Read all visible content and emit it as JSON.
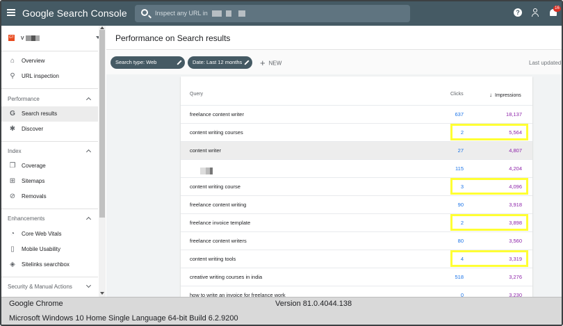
{
  "topbar": {
    "brand": "Google Search Console",
    "search_placeholder": "Inspect any URL in",
    "notification_count": "16",
    "help_glyph": "?"
  },
  "sidebar": {
    "property_name": "v",
    "property_favicon_text": "GT",
    "items": [
      {
        "label": "Overview",
        "icon": "home-icon"
      },
      {
        "label": "URL inspection",
        "icon": "search-icon"
      },
      {
        "section": "Performance"
      },
      {
        "label": "Search results",
        "icon": "google-g-icon",
        "active": true
      },
      {
        "label": "Discover",
        "icon": "asterisk-icon"
      },
      {
        "section": "Index"
      },
      {
        "label": "Coverage",
        "icon": "file-copy-icon"
      },
      {
        "label": "Sitemaps",
        "icon": "sitemap-icon"
      },
      {
        "label": "Removals",
        "icon": "eye-off-icon"
      },
      {
        "section": "Enhancements"
      },
      {
        "label": "Core Web Vitals",
        "icon": "speedometer-icon"
      },
      {
        "label": "Mobile Usability",
        "icon": "phone-icon"
      },
      {
        "label": "Sitelinks searchbox",
        "icon": "layers-icon"
      },
      {
        "section": "Security & Manual Actions"
      }
    ]
  },
  "page": {
    "title": "Performance on Search results",
    "chips": [
      "Search type: Web",
      "Date: Last 12 months"
    ],
    "new_label": "NEW",
    "last_updated": "Last updated"
  },
  "table": {
    "headers": {
      "query": "Query",
      "clicks": "Clicks",
      "impressions": "Impressions"
    },
    "rows": [
      {
        "query": "freelance content writer",
        "clicks": "637",
        "impressions": "18,137"
      },
      {
        "query": "content writing courses",
        "clicks": "2",
        "impressions": "5,564",
        "highlight": true
      },
      {
        "query": "content writer",
        "clicks": "27",
        "impressions": "4,807",
        "hover": true
      },
      {
        "query": "",
        "clicks": "115",
        "impressions": "4,204",
        "redacted": true
      },
      {
        "query": "content writing course",
        "clicks": "3",
        "impressions": "4,096",
        "highlight": true
      },
      {
        "query": "freelance content writing",
        "clicks": "90",
        "impressions": "3,918"
      },
      {
        "query": "freelance invoice template",
        "clicks": "2",
        "impressions": "3,898",
        "highlight": true
      },
      {
        "query": "freelance content writers",
        "clicks": "80",
        "impressions": "3,560"
      },
      {
        "query": "content writing tools",
        "clicks": "4",
        "impressions": "3,319",
        "highlight": true
      },
      {
        "query": "creative writing courses in india",
        "clicks": "518",
        "impressions": "3,276"
      },
      {
        "query": "how to write an invoice for freelance work",
        "clicks": "0",
        "impressions": "3,230"
      }
    ]
  },
  "infobar": {
    "browser": "Google Chrome",
    "version": "Version 81.0.4044.138",
    "os": "Microsoft Windows 10 Home Single Language 64-bit Build 6.2.9200"
  },
  "colors": {
    "topbar": "#455a64",
    "clicks": "#1a73e8",
    "impressions": "#8e24aa",
    "highlight_box": "#ffff33"
  }
}
